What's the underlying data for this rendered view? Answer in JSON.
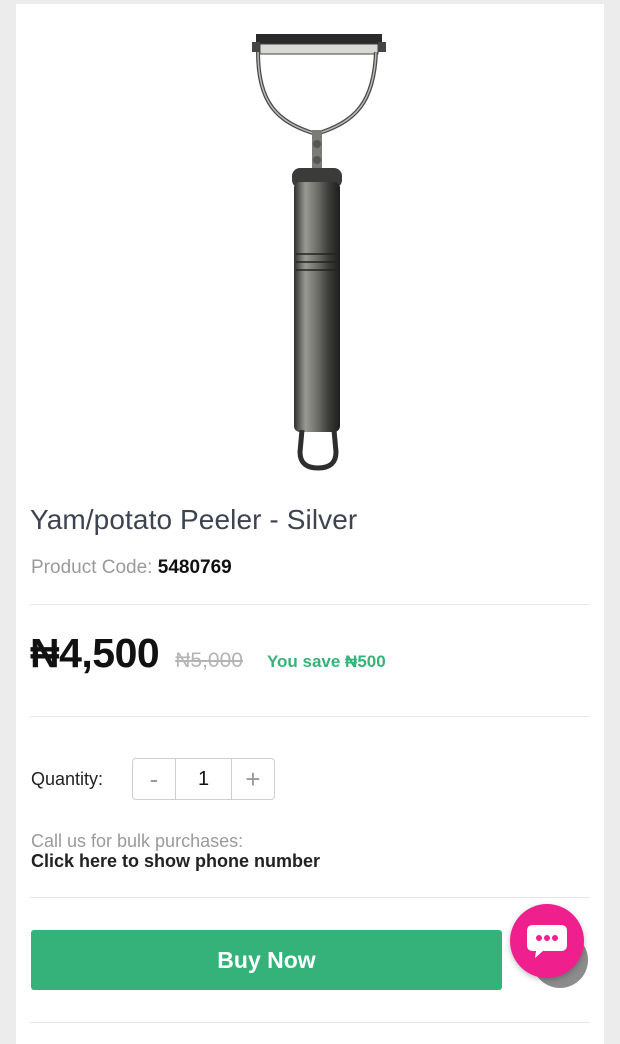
{
  "product": {
    "title": "Yam/potato Peeler - Silver",
    "code_label": "Product Code:",
    "code_value": "5480769",
    "image_icon": "potato-peeler"
  },
  "pricing": {
    "price": "₦4,500",
    "old_price": "₦5,000",
    "savings": "You save ₦500"
  },
  "quantity": {
    "label": "Quantity:",
    "minus": "-",
    "value": "1",
    "plus": "+"
  },
  "bulk": {
    "prompt": "Call us for bulk purchases:",
    "link": "Click here to show phone number"
  },
  "actions": {
    "buy_now": "Buy Now",
    "chat_icon": "chat-bubble",
    "scroll_icon": "scroll-to-top"
  },
  "colors": {
    "accent": "#34b27a",
    "chat": "#ef1f8e",
    "savings": "#35b37a"
  }
}
